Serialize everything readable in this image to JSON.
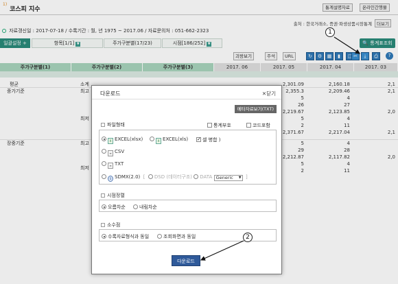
{
  "title": {
    "num": "1)",
    "text": "코스피 지수"
  },
  "top_buttons": [
    "통계설명자료",
    "온라인간행물"
  ],
  "source": {
    "text": "출처 : 한국거래소, 증권·파생상품시장통계",
    "more": "더보기"
  },
  "info": "자료갱신일 : 2017-07-18 / 수록기간 : 월, 년 1975 ~ 2017.06 / 자료문의처 : 051-662-2323",
  "tabs": {
    "setting": "일괄설정 +",
    "item": "항목[1/1]",
    "cat": "주가구분별(17/23)",
    "period": "시점[186/252]",
    "run": "통계표조회"
  },
  "toolbar": {
    "fix": "괴왕보기",
    "note": "주석",
    "url": "URL"
  },
  "table": {
    "headers": [
      "주가구분별(1)",
      "주가구분별(2)",
      "주가구분별(3)"
    ],
    "periods": [
      "2017. 06",
      "2017. 05",
      "2017. 04",
      "2017. 03"
    ],
    "row_labels": {
      "avg": "평균",
      "sub": "소계",
      "close": "종가기준",
      "hi": "최고",
      "lo": "최저",
      "intra": "장중기준",
      "hi2": "최고",
      "lo2": "최저"
    },
    "col2_values": [
      "2,301.09",
      "2,355.3",
      "5",
      "26",
      "2,219.67",
      "5",
      "2",
      "2,371.67",
      "5",
      "29",
      "2,212.87",
      "5",
      "2"
    ],
    "col3_values": [
      "2,160.18",
      "2,209.46",
      "4",
      "27",
      "2,123.85",
      "4",
      "11",
      "2,217.04",
      "4",
      "28",
      "2,117.82",
      "4",
      "11"
    ],
    "col4_values": [
      "2,1",
      "2,1",
      "",
      "",
      "2,0",
      "",
      "",
      "2,1",
      "",
      "",
      "2,0",
      "",
      ""
    ]
  },
  "modal": {
    "title": "다운로드",
    "close": "닫기",
    "meta": "메타자료보기(TXT)",
    "file_format": {
      "label": "파일형태",
      "stat_symbol": "통계부호",
      "code_include": "코드포함",
      "xlsx": "EXCEL(xlsx)",
      "xls": "EXCEL(xls)",
      "merge": "셀 병합",
      "csv": "CSV",
      "txt": "TXT",
      "sdmx": "SDMX(2.0)",
      "dsd": "DSD (데이터구조)",
      "data": "DATA",
      "generic": "Generic"
    },
    "period_sort": {
      "label": "시점정렬",
      "asc": "오름차순",
      "desc": "내림차순"
    },
    "decimal": {
      "label": "소수점",
      "as_stored": "수록자료형식과 동일",
      "as_view": "조회화면과 동일"
    },
    "download_btn": "다운로드"
  },
  "callouts": [
    "1",
    "2"
  ]
}
